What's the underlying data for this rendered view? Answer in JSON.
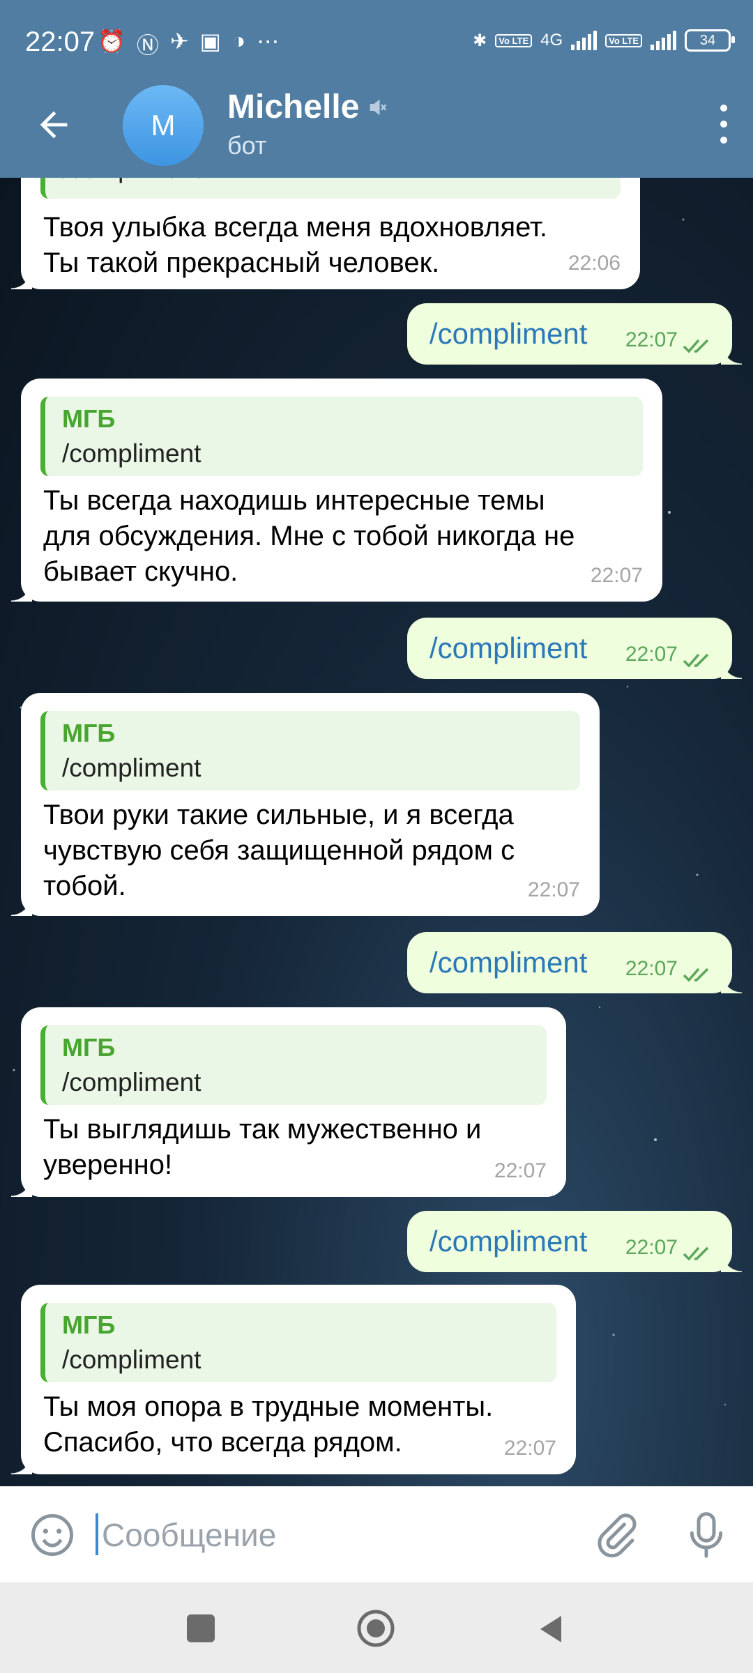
{
  "status_bar": {
    "time": "22:07",
    "network_label": "4G",
    "volte": "Vo LTE",
    "battery": "34"
  },
  "header": {
    "avatar_letter": "M",
    "title": "Michelle",
    "subtitle": "бот"
  },
  "messages": [
    {
      "dir": "in",
      "quote_name": "",
      "quote_text": "/compliment",
      "text_lines": [
        "Твоя улыбка всегда меня вдохновляет.",
        "Ты такой прекрасный человек."
      ],
      "time": "22:06"
    },
    {
      "dir": "out",
      "text": "/compliment",
      "time": "22:07"
    },
    {
      "dir": "in",
      "quote_name": "МГБ",
      "quote_text": "/compliment",
      "text_lines": [
        "Ты всегда находишь интересные темы",
        "для обсуждения. Мне с тобой никогда не",
        "бывает скучно."
      ],
      "time": "22:07"
    },
    {
      "dir": "out",
      "text": "/compliment",
      "time": "22:07"
    },
    {
      "dir": "in",
      "quote_name": "МГБ",
      "quote_text": "/compliment",
      "text_lines": [
        "Твои руки такие сильные, и я всегда",
        "чувствую себя защищенной рядом с",
        "тобой."
      ],
      "time": "22:07"
    },
    {
      "dir": "out",
      "text": "/compliment",
      "time": "22:07"
    },
    {
      "dir": "in",
      "quote_name": "МГБ",
      "quote_text": "/compliment",
      "text_lines": [
        "Ты выглядишь так мужественно и",
        "уверенно!"
      ],
      "time": "22:07"
    },
    {
      "dir": "out",
      "text": "/compliment",
      "time": "22:07"
    },
    {
      "dir": "in",
      "quote_name": "МГБ",
      "quote_text": "/compliment",
      "text_lines": [
        "Ты моя опора в трудные моменты.",
        "Спасибо, что всегда рядом."
      ],
      "time": "22:07"
    }
  ],
  "composer": {
    "placeholder": "Сообщение"
  },
  "icons": {
    "back": "arrow-left-icon",
    "mute": "muted-speaker-icon",
    "menu": "more-vert-icon",
    "emoji": "emoji-icon",
    "attach": "paperclip-icon",
    "mic": "microphone-icon"
  },
  "colors": {
    "header": "#517da2",
    "outgoing_bubble": "#effedd",
    "incoming_bubble": "#ffffff",
    "quote_accent": "#48b030",
    "command_link": "#2a78b8"
  }
}
